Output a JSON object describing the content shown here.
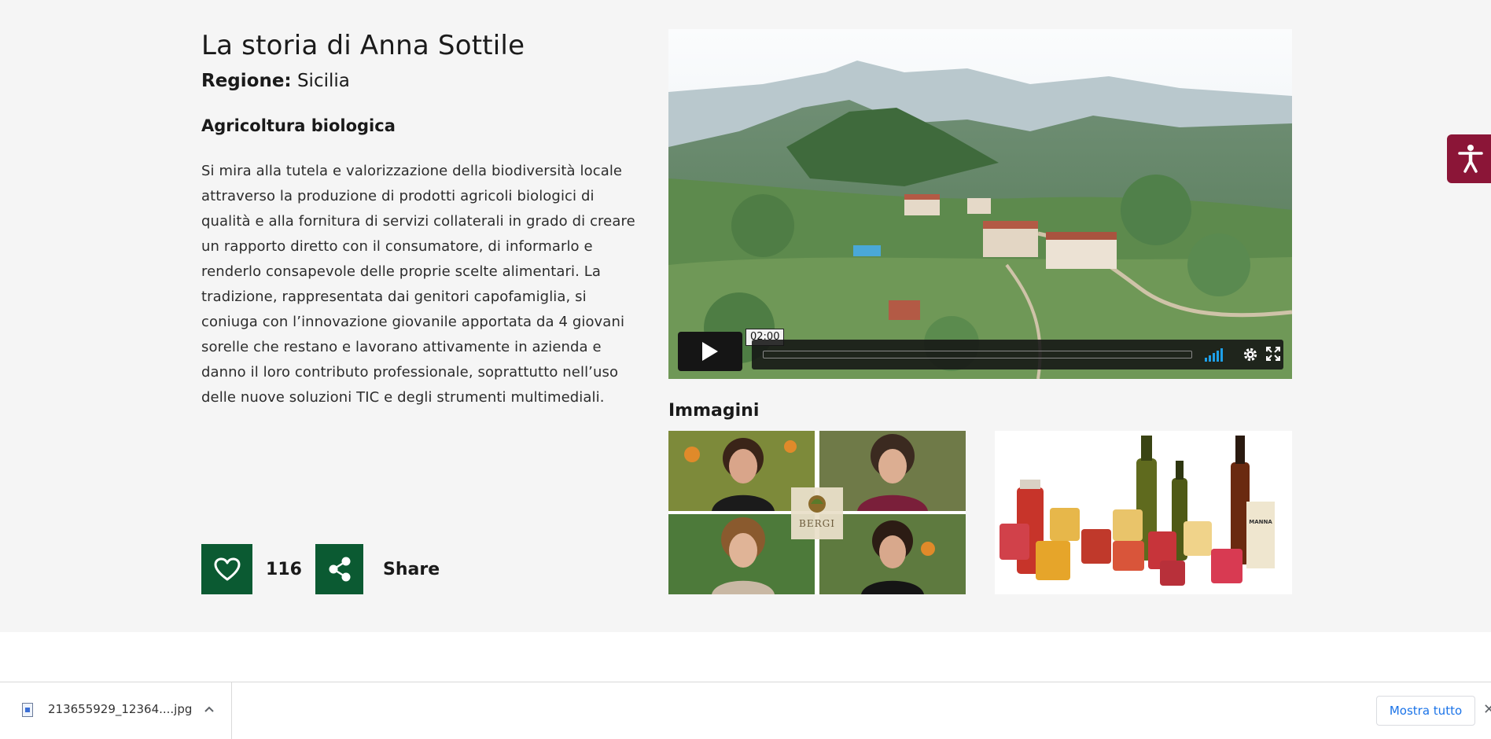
{
  "story": {
    "title": "La storia di Anna Sottile",
    "region_label": "Regione:",
    "region_value": "Sicilia",
    "category": "Agricoltura biologica",
    "description": "Si mira alla tutela e valorizzazione della biodiversità locale attraverso la produzione di prodotti agricoli biologici di qualità e alla fornitura di servizi collaterali in grado di creare un rapporto diretto con il consumatore, di informarlo e renderlo consapevole delle proprie scelte alimentari. La tradizione, rappresentata dai genitori capofamiglia, si coniuga con l’innovazione giovanile apportata da 4 giovani sorelle che restano e lavorano attivamente in azienda e danno il loro contributo professionale, soprattutto nell’uso delle nuove soluzioni TIC e degli strumenti multimediali."
  },
  "actions": {
    "like_icon": "heart-icon",
    "like_count": "116",
    "share_icon": "share-icon",
    "share_label": "Share"
  },
  "video": {
    "duration": "02:00",
    "progress": 0,
    "icons": [
      "play-icon",
      "volume-icon",
      "gear-icon",
      "fullscreen-icon"
    ]
  },
  "gallery": {
    "title": "Immagini",
    "images": [
      {
        "logo_text": "BERGI"
      },
      {
        "label": "MANNA"
      }
    ]
  },
  "accessibility": {
    "icon": "accessibility-icon"
  },
  "download_shelf": {
    "file_name": "213655929_12364....jpg",
    "show_all_label": "Mostra tutto",
    "close_label": "✕"
  },
  "colors": {
    "brand_green": "#0b5a32",
    "accessibility_red": "#8b1537",
    "band_bg": "#f5f5f5",
    "link_blue": "#1a73e8"
  }
}
